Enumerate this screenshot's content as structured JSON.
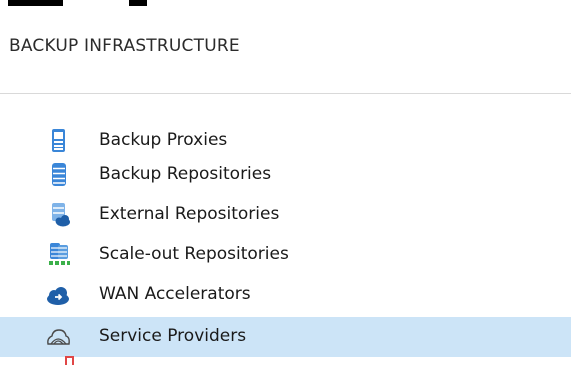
{
  "panel": {
    "title": "BACKUP INFRASTRUCTURE"
  },
  "tree": {
    "items": [
      {
        "label": "Backup Proxies",
        "icon": "backup-proxy-icon",
        "selected": false
      },
      {
        "label": "Backup Repositories",
        "icon": "backup-repository-icon",
        "selected": false
      },
      {
        "label": "External Repositories",
        "icon": "external-repository-icon",
        "selected": false
      },
      {
        "label": "Scale-out Repositories",
        "icon": "scale-out-repository-icon",
        "selected": false
      },
      {
        "label": "WAN Accelerators",
        "icon": "wan-accelerator-icon",
        "selected": false
      },
      {
        "label": "Service Providers",
        "icon": "service-provider-icon",
        "selected": true
      }
    ]
  },
  "colors": {
    "selection": "#cce4f7",
    "icon_blue": "#3a86d8",
    "icon_dark": "#1f5fa8",
    "cut_icon_red": "#e04646"
  }
}
